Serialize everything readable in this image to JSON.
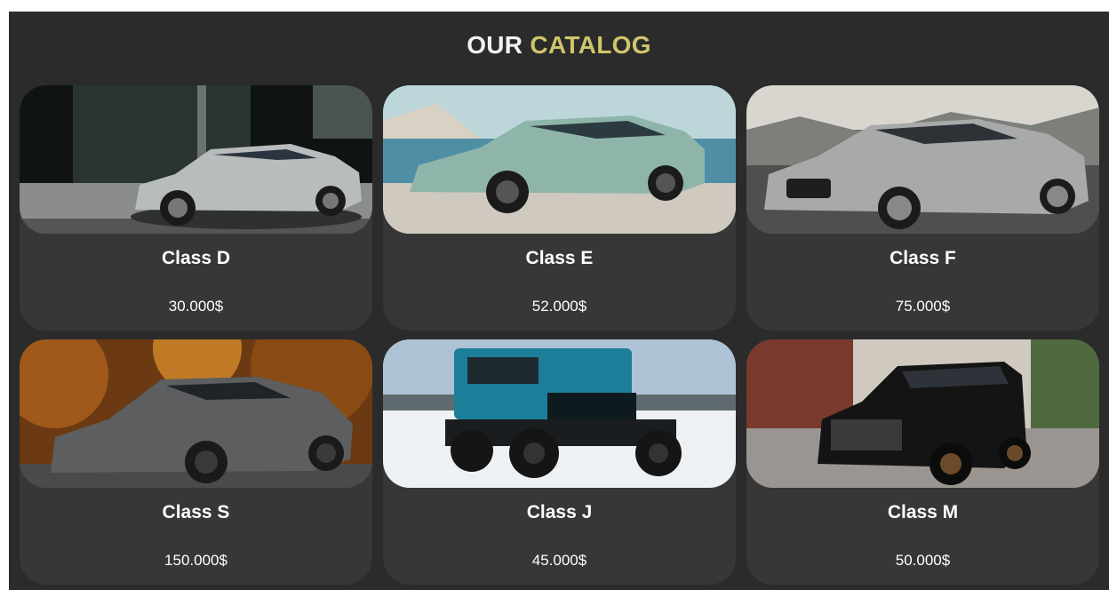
{
  "catalog": {
    "title_word1": "OUR",
    "title_word2": "CATALOG",
    "accent_color": "#cfc56a",
    "background_color": "#2b2b2b",
    "card_color": "#373737"
  },
  "cars": [
    {
      "name": "Class D",
      "price": "30.000$",
      "image": "silver-sedan-city-photo"
    },
    {
      "name": "Class E",
      "price": "52.000$",
      "image": "mint-sedan-beach-photo"
    },
    {
      "name": "Class F",
      "price": "75.000$",
      "image": "silver-sportback-mountain-photo"
    },
    {
      "name": "Class S",
      "price": "150.000$",
      "image": "grey-sports-car-autumn-photo"
    },
    {
      "name": "Class J",
      "price": "45.000$",
      "image": "blue-offroad-snow-photo"
    },
    {
      "name": "Class M",
      "price": "50.000$",
      "image": "black-minivan-street-photo"
    }
  ]
}
